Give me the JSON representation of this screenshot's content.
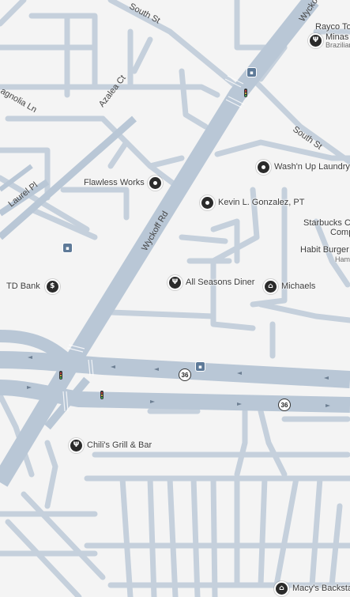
{
  "roads": {
    "south_st_top": "South St",
    "south_st_right": "South St",
    "wyckoff_rd": "Wyckoff Rd",
    "wyckoff_top": "Wyckoff",
    "azalea_ct": "Azalea Ct",
    "magnolia_ln": "agnolia Ln",
    "laurel_pl": "Laurel Pl"
  },
  "route_shields": [
    "36",
    "36"
  ],
  "pois": {
    "rayco": {
      "label": "Rayco Tot"
    },
    "minas": {
      "label": "Minas G",
      "sub": "Brazilian",
      "icon": "restaurant-icon"
    },
    "washn_up": {
      "label": "Wash'n Up Laundry",
      "icon": "map-pin-icon"
    },
    "flawless": {
      "label": "Flawless Works",
      "icon": "map-pin-icon"
    },
    "kevin": {
      "label": "Kevin L. Gonzalez, PT",
      "icon": "map-pin-icon"
    },
    "starbucks": {
      "label1": "Starbucks Co",
      "label2": "Comp"
    },
    "habit": {
      "label": "Habit Burger &",
      "sub": "Hamb"
    },
    "td_bank": {
      "label": "TD Bank",
      "icon": "bank-icon",
      "glyph": "$"
    },
    "all_seasons": {
      "label": "All Seasons Diner",
      "icon": "restaurant-icon"
    },
    "michaels": {
      "label": "Michaels",
      "icon": "shopping-bag-icon"
    },
    "chilis": {
      "label": "Chili's Grill & Bar",
      "icon": "restaurant-icon"
    },
    "macys": {
      "label": "Macy's Backstag",
      "icon": "shopping-bag-icon"
    }
  },
  "colors": {
    "background": "#f4f4f4",
    "major_road": "#b9c7d6",
    "minor_road": "#c5d0dc",
    "pin": "#2b2b2b"
  }
}
